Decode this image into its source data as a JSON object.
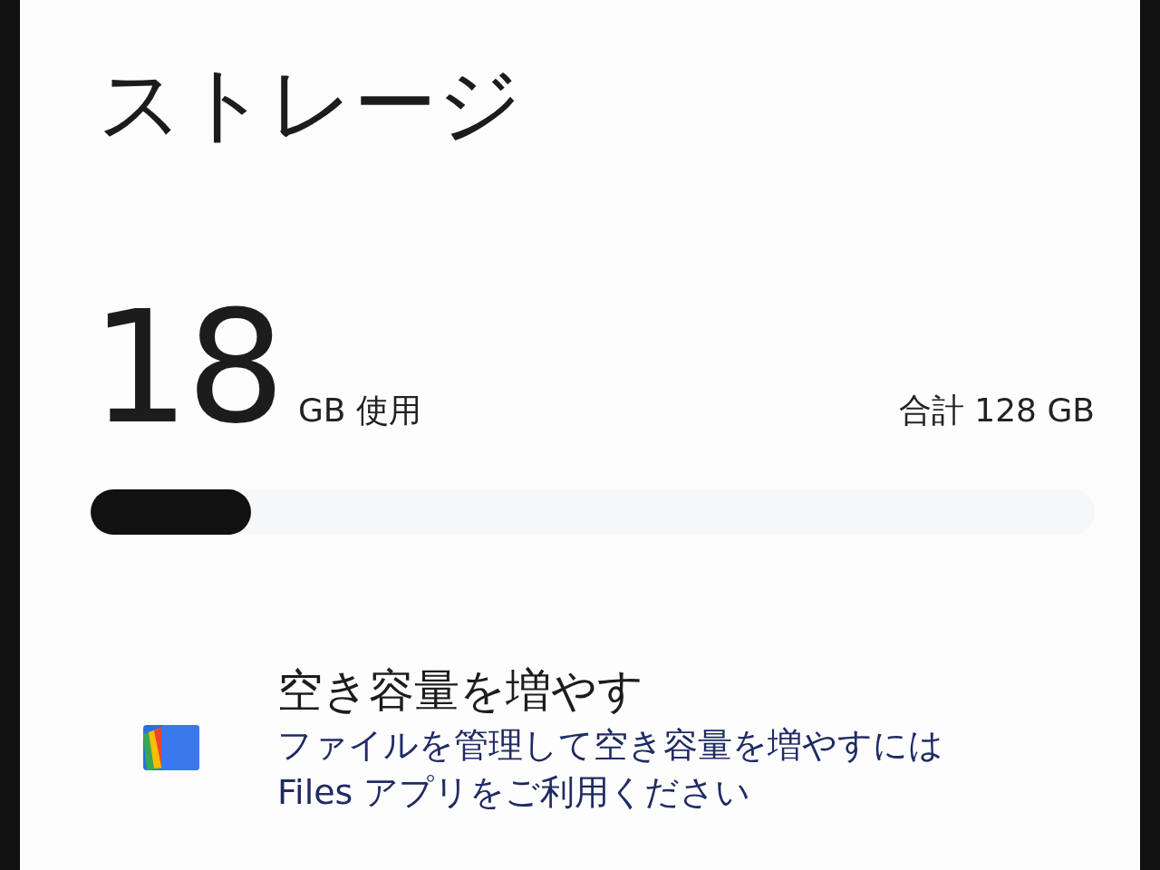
{
  "title": "ストレージ",
  "usage": {
    "used_value": "18",
    "used_unit": "GB 使用",
    "total": "合計 128 GB",
    "level": 0.16
  },
  "suggestion": {
    "title": "空き容量を増やす",
    "description_lines": [
      "ファイルを管理して空き容量を増やすには",
      "Files アプリをご利用ください"
    ]
  }
}
